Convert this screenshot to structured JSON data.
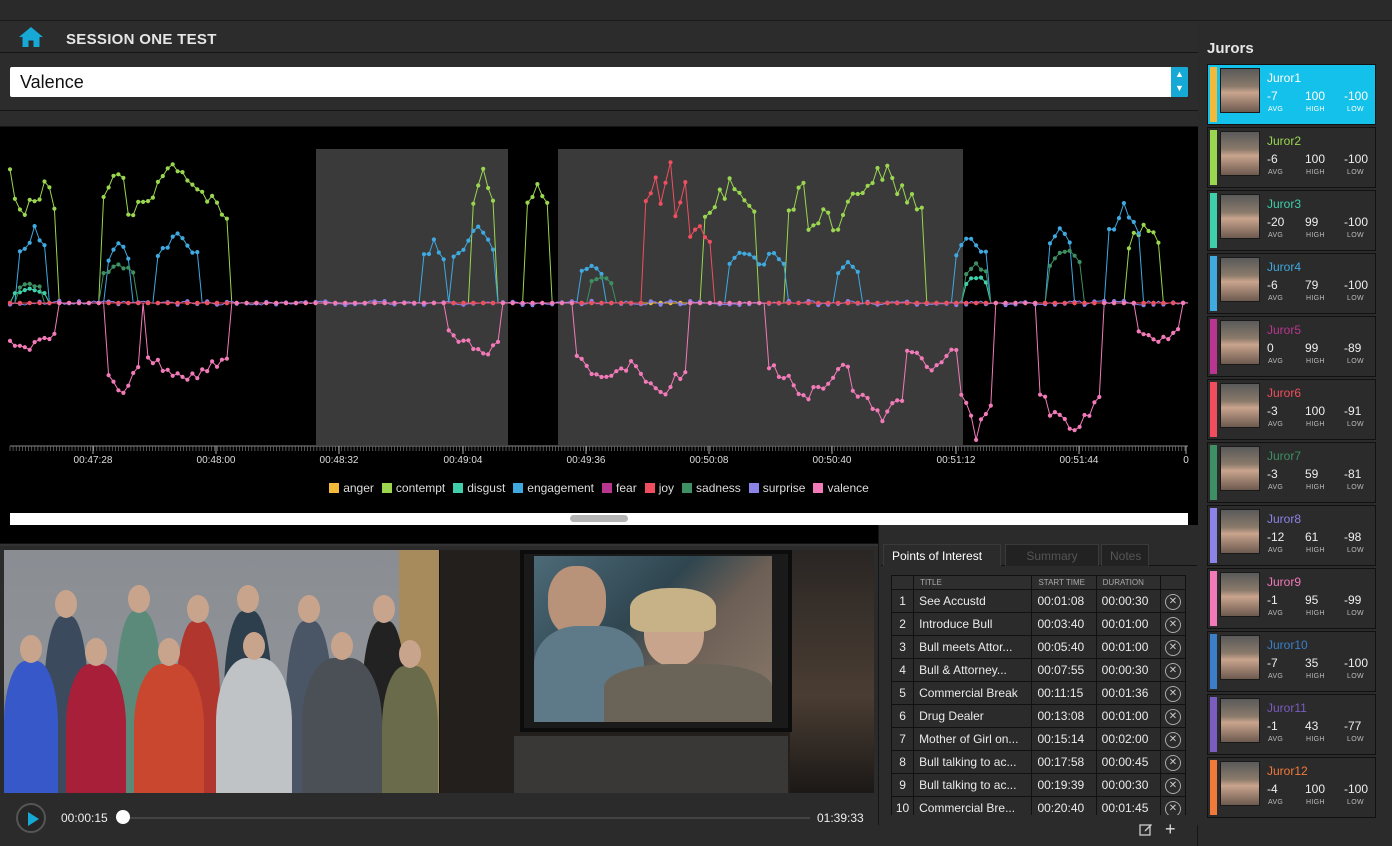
{
  "app": {
    "session_title": "SESSION ONE TEST",
    "metric_select": {
      "value": "Valence"
    }
  },
  "chart_data": {
    "type": "line",
    "x_ticks": [
      "00:47:28",
      "00:48:00",
      "00:48:32",
      "00:49:04",
      "00:49:36",
      "00:50:08",
      "00:50:40",
      "00:51:12",
      "00:51:44",
      "0"
    ],
    "series": [
      {
        "name": "anger",
        "color": "#f2b93b"
      },
      {
        "name": "contempt",
        "color": "#9ad64f"
      },
      {
        "name": "disgust",
        "color": "#3fcfaa"
      },
      {
        "name": "engagement",
        "color": "#3fa9e0"
      },
      {
        "name": "fear",
        "color": "#b8368f"
      },
      {
        "name": "joy",
        "color": "#f04e5e"
      },
      {
        "name": "sadness",
        "color": "#3e8f63"
      },
      {
        "name": "surprise",
        "color": "#8c83e8"
      },
      {
        "name": "valence",
        "color": "#f27ab8"
      }
    ],
    "grid": false,
    "legend_position": "bottom"
  },
  "video": {
    "current_time": "00:00:15",
    "total_time": "01:39:33",
    "progress": 0.003
  },
  "poi": {
    "tabs": [
      "Points of Interest",
      "Summary",
      "Notes"
    ],
    "columns": [
      "TITLE",
      "START TIME",
      "DURATION"
    ],
    "rows": [
      {
        "n": "1",
        "title": "See Accustd",
        "start": "00:01:08",
        "duration": "00:00:30"
      },
      {
        "n": "2",
        "title": "Introduce Bull",
        "start": "00:03:40",
        "duration": "00:01:00"
      },
      {
        "n": "3",
        "title": "Bull meets Attor...",
        "start": "00:05:40",
        "duration": "00:01:00"
      },
      {
        "n": "4",
        "title": "Bull & Attorney...",
        "start": "00:07:55",
        "duration": "00:00:30"
      },
      {
        "n": "5",
        "title": "Commercial Break",
        "start": "00:11:15",
        "duration": "00:01:36"
      },
      {
        "n": "6",
        "title": "Drug Dealer",
        "start": "00:13:08",
        "duration": "00:01:00"
      },
      {
        "n": "7",
        "title": "Mother of Girl on...",
        "start": "00:15:14",
        "duration": "00:02:00"
      },
      {
        "n": "8",
        "title": "Bull talking to ac...",
        "start": "00:17:58",
        "duration": "00:00:45"
      },
      {
        "n": "9",
        "title": "Bull talking to ac...",
        "start": "00:19:39",
        "duration": "00:00:30"
      },
      {
        "n": "10",
        "title": "Commercial Bre...",
        "start": "00:20:40",
        "duration": "00:01:45"
      }
    ]
  },
  "sidebar": {
    "title": "Jurors",
    "stat_labels": {
      "avg": "AVG",
      "high": "HIGH",
      "low": "LOW"
    },
    "jurors": [
      {
        "name": "Juror1",
        "avg": "-7",
        "high": "100",
        "low": "-100",
        "color": "#f2b93b"
      },
      {
        "name": "Juror2",
        "avg": "-6",
        "high": "100",
        "low": "-100",
        "color": "#9ad64f"
      },
      {
        "name": "Juror3",
        "avg": "-20",
        "high": "99",
        "low": "-100",
        "color": "#3fcfaa"
      },
      {
        "name": "Juror4",
        "avg": "-6",
        "high": "79",
        "low": "-100",
        "color": "#3fa9e0"
      },
      {
        "name": "Juror5",
        "avg": "0",
        "high": "99",
        "low": "-89",
        "color": "#b8368f"
      },
      {
        "name": "Juror6",
        "avg": "-3",
        "high": "100",
        "low": "-91",
        "color": "#f04e5e"
      },
      {
        "name": "Juror7",
        "avg": "-3",
        "high": "59",
        "low": "-81",
        "color": "#3e8f63"
      },
      {
        "name": "Juror8",
        "avg": "-12",
        "high": "61",
        "low": "-98",
        "color": "#8c83e8"
      },
      {
        "name": "Juror9",
        "avg": "-1",
        "high": "95",
        "low": "-99",
        "color": "#f27ab8"
      },
      {
        "name": "Juror10",
        "avg": "-7",
        "high": "35",
        "low": "-100",
        "color": "#3a7fc8"
      },
      {
        "name": "Juror11",
        "avg": "-1",
        "high": "43",
        "low": "-77",
        "color": "#7b5cc0"
      },
      {
        "name": "Juror12",
        "avg": "-4",
        "high": "100",
        "low": "-100",
        "color": "#f07a3a"
      }
    ]
  }
}
